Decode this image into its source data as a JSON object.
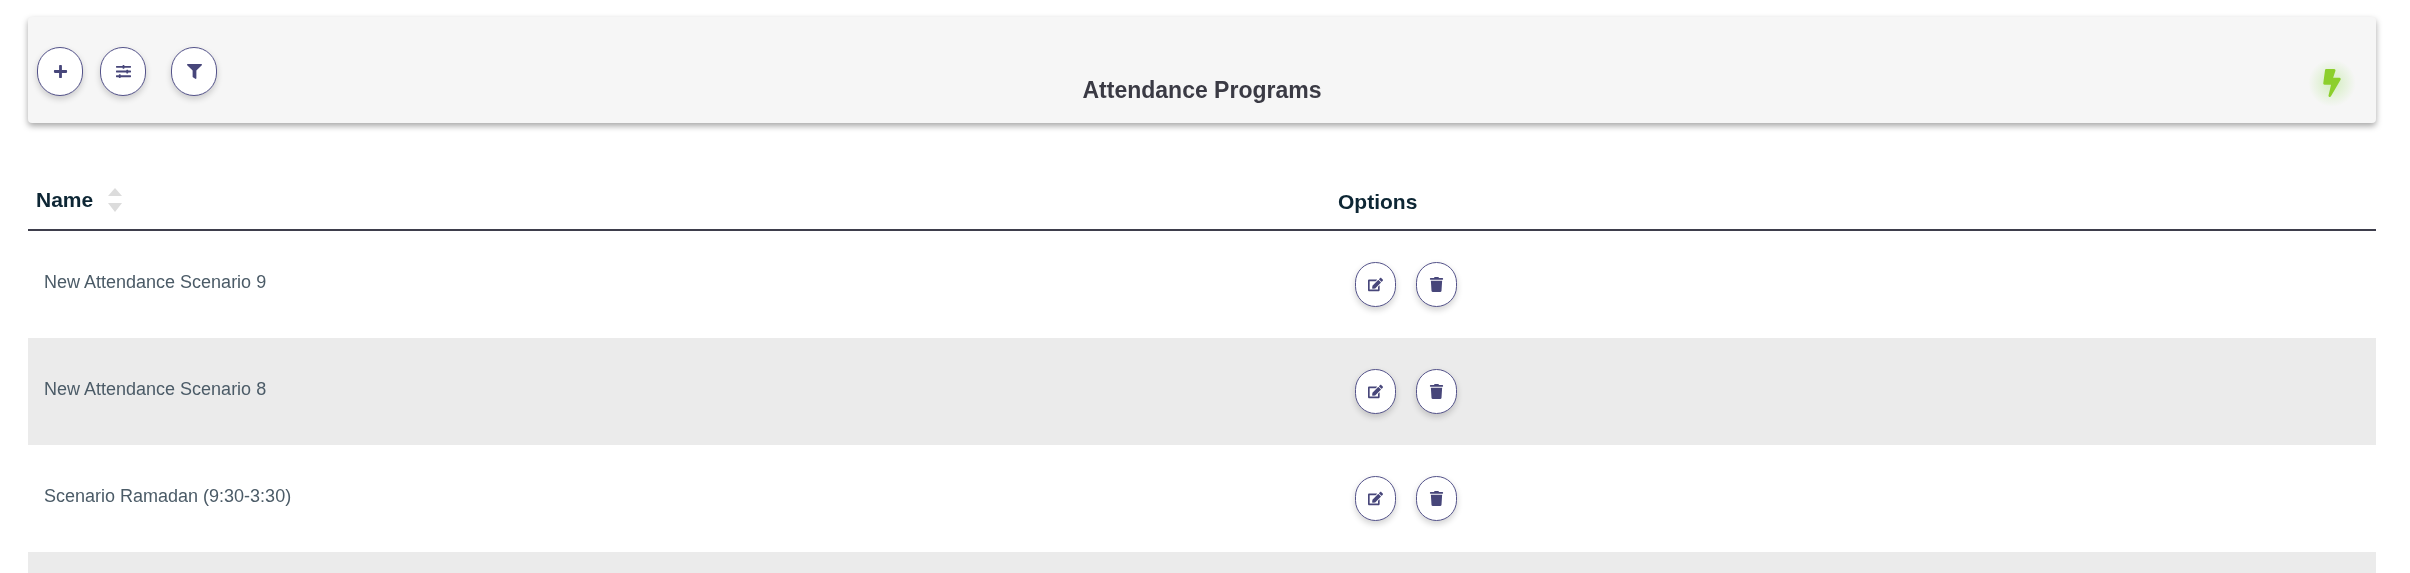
{
  "toolbar": {
    "title": "Attendance Programs",
    "buttons": [
      {
        "kind": "add"
      },
      {
        "kind": "adjust"
      },
      {
        "kind": "filter"
      }
    ]
  },
  "table": {
    "columns": [
      "Name",
      "Options"
    ],
    "row_actions": [
      {
        "kind": "edit"
      },
      {
        "kind": "delete"
      }
    ],
    "rows": [
      {
        "name": "New Attendance Scenario 9"
      },
      {
        "name": "New Attendance Scenario 8"
      },
      {
        "name": "Scenario Ramadan (9:30-3:30)"
      }
    ]
  }
}
